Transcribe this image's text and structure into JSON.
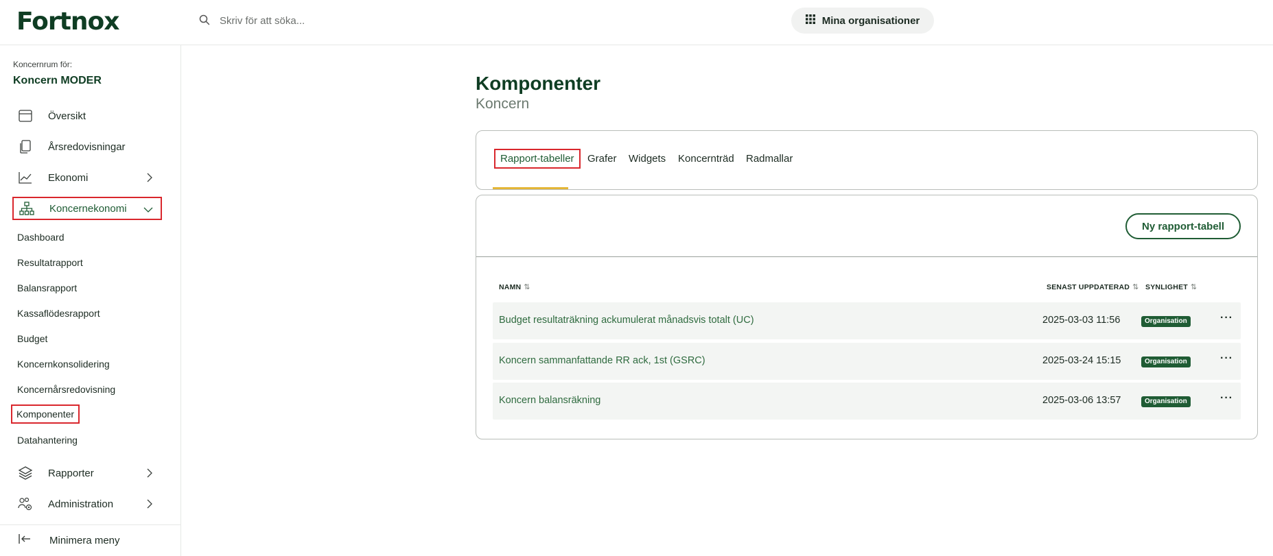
{
  "header": {
    "logo": "Fortnox",
    "search_placeholder": "Skriv för att söka...",
    "org_button": "Mina organisationer"
  },
  "sidebar": {
    "context_label": "Koncernrum för:",
    "context_name": "Koncern MODER",
    "items": [
      {
        "label": "Översikt",
        "icon": "calendar-window-icon"
      },
      {
        "label": "Årsredovisningar",
        "icon": "documents-icon"
      },
      {
        "label": "Ekonomi",
        "icon": "line-chart-icon"
      },
      {
        "label": "Koncernekonomi",
        "icon": "org-tree-icon"
      },
      {
        "label": "Rapporter",
        "icon": "layers-icon"
      },
      {
        "label": "Administration",
        "icon": "users-gear-icon"
      }
    ],
    "sub_items": [
      "Dashboard",
      "Resultatrapport",
      "Balansrapport",
      "Kassaflödesrapport",
      "Budget",
      "Koncernkonsolidering",
      "Koncernårsredovisning",
      "Komponenter",
      "Datahantering"
    ],
    "minimize": "Minimera meny"
  },
  "main": {
    "title": "Komponenter",
    "subtitle": "Koncern",
    "tabs": [
      "Rapport-tabeller",
      "Grafer",
      "Widgets",
      "Koncernträd",
      "Radmallar"
    ],
    "new_button": "Ny rapport-tabell",
    "columns": {
      "name": "NAMN",
      "updated": "SENAST UPPDATERAD",
      "visibility": "SYNLIGHET"
    },
    "rows": [
      {
        "name": "Budget resultaträkning ackumulerat månadsvis totalt (UC)",
        "updated": "2025-03-03 11:56",
        "visibility": "Organisation"
      },
      {
        "name": "Koncern sammanfattande RR ack, 1st (GSRC)",
        "updated": "2025-03-24 15:15",
        "visibility": "Organisation"
      },
      {
        "name": "Koncern balansräkning",
        "updated": "2025-03-06 13:57",
        "visibility": "Organisation"
      }
    ],
    "row_menu": "···",
    "sort_glyph": "⇅"
  },
  "colors": {
    "brand": "#0f3d23",
    "accent_green": "#1f5c34",
    "tab_underline": "#e4b637",
    "highlight": "#d9262c"
  }
}
